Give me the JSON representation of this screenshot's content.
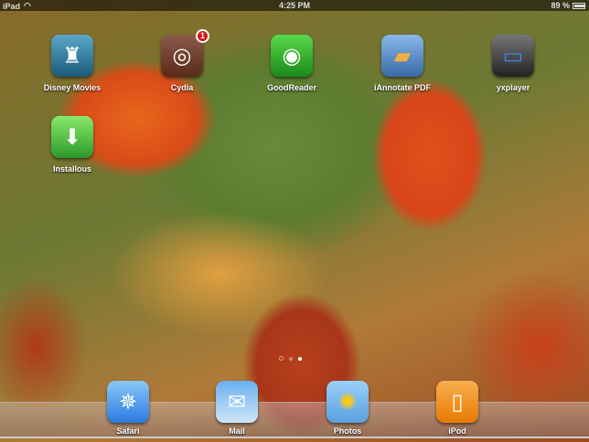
{
  "status_bar": {
    "device": "iPad",
    "time": "4:25 PM",
    "battery": "89 %",
    "battery_level": 0.89
  },
  "apps": [
    {
      "name": "Disney Movies",
      "icon": "castle-icon",
      "color": "#2a6a8a"
    },
    {
      "name": "Cydia",
      "icon": "box-icon",
      "color": "#6a3a2a",
      "badge": "1"
    },
    {
      "name": "GoodReader",
      "icon": "eye-icon",
      "color": "#2a9a2a"
    },
    {
      "name": "iAnnotate PDF",
      "icon": "toolbox-icon",
      "color": "#3a6aa8"
    },
    {
      "name": "yxplayer",
      "icon": "tv-icon",
      "color": "#333333"
    },
    {
      "name": "Installous",
      "icon": "download-icon",
      "color": "#4ab83a"
    }
  ],
  "page_indicator": {
    "pages": 3,
    "current": 3
  },
  "dock": [
    {
      "name": "Safari",
      "icon": "compass-icon",
      "color": "#3a8ae8"
    },
    {
      "name": "Mail",
      "icon": "envelope-icon",
      "color": "#4a9ae8"
    },
    {
      "name": "Photos",
      "icon": "sunflower-icon",
      "color": "#7ab8e8"
    },
    {
      "name": "iPod",
      "icon": "ipod-icon",
      "color": "#f08a10"
    }
  ]
}
